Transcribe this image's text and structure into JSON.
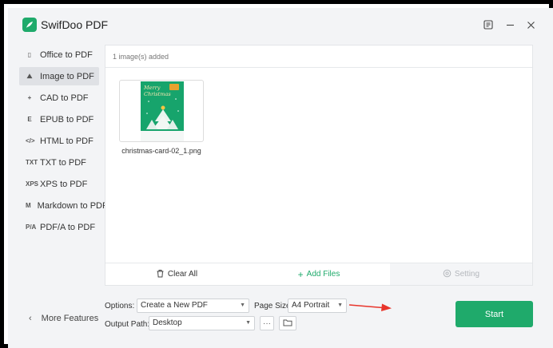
{
  "app": {
    "title": "SwifDoo PDF"
  },
  "sidebar": {
    "items": [
      {
        "label": "Office to PDF",
        "icon": "office-icon",
        "glyph": "▯"
      },
      {
        "label": "Image to PDF",
        "icon": "image-icon",
        "glyph": "⛰",
        "active": true
      },
      {
        "label": "CAD to PDF",
        "icon": "cad-icon",
        "glyph": "+"
      },
      {
        "label": "EPUB to PDF",
        "icon": "epub-icon",
        "glyph": "E"
      },
      {
        "label": "HTML to PDF",
        "icon": "html-icon",
        "glyph": "</>"
      },
      {
        "label": "TXT to PDF",
        "icon": "txt-icon",
        "glyph": "TXT"
      },
      {
        "label": "XPS to PDF",
        "icon": "xps-icon",
        "glyph": "XPS"
      },
      {
        "label": "Markdown to PDF",
        "icon": "markdown-icon",
        "glyph": "M"
      },
      {
        "label": "PDF/A to PDF",
        "icon": "pdfa-icon",
        "glyph": "P/A"
      }
    ],
    "more_features": "More Features"
  },
  "panel": {
    "count_label": "1 image(s) added",
    "file": {
      "name": "christmas-card-02_1.png",
      "card_text_1": "Merry",
      "card_text_2": "Christmas"
    },
    "clear_all": "Clear All",
    "add_files": "Add Files",
    "setting": "Setting"
  },
  "options": {
    "options_label": "Options:",
    "options_value": "Create a New PDF",
    "page_size_label": "Page Size:",
    "page_size_value": "A4 Portrait",
    "output_path_label": "Output Path:",
    "output_path_value": "Desktop",
    "more_button": "···"
  },
  "start_label": "Start",
  "colors": {
    "accent": "#1faa6b",
    "arrow": "#e8352b"
  }
}
